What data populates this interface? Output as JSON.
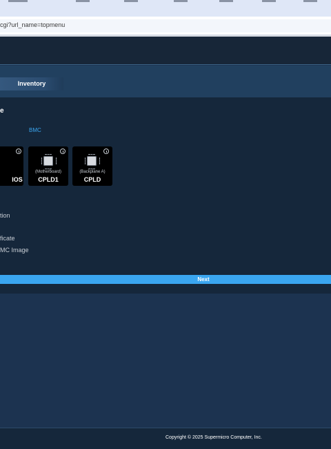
{
  "browser": {
    "url": "cgi?url_name=topmenu"
  },
  "tabs": [
    {
      "label": "Inventory"
    }
  ],
  "panel": {
    "title": "e",
    "bmc_link": "BMC",
    "cards": [
      {
        "subtitle": "",
        "name": "IOS"
      },
      {
        "subtitle": "(Motherboard)",
        "name": "CPLD1"
      },
      {
        "subtitle": "(Backplane A)",
        "name": "CPLD"
      }
    ],
    "options": [
      "tion",
      "ficate",
      "MC Image"
    ],
    "next_label": "Next"
  },
  "footer": {
    "copyright": "Copyright © 2025 Supermicro Computer, Inc."
  },
  "colors": {
    "accent": "#3aa6f0",
    "panel_bg": "#15273b",
    "page_bg": "#1c3350"
  }
}
